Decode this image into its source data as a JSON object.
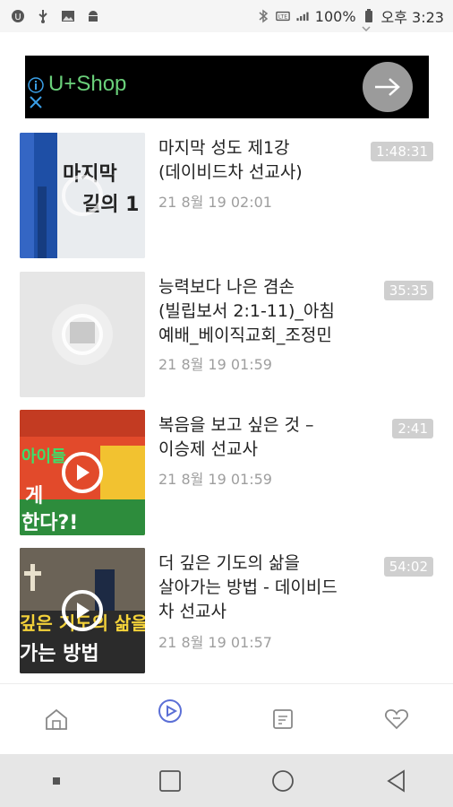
{
  "status_bar": {
    "battery": "100%",
    "time": "오후 3:23"
  },
  "ad": {
    "text": "U+Shop"
  },
  "videos": [
    {
      "title": "마지막 성도 제1강\n(데이비드차 선교사)",
      "date": "21 8월 19 02:01",
      "duration": "1:48:31",
      "thumb_text_1": "마지막",
      "thumb_text_2": "길의 1"
    },
    {
      "title": "능력보다 나은 겸손\n(빌립보서 2:1-11)_아침\n예배_베이직교회_조정민",
      "date": "21 8월 19 01:59",
      "duration": "35:35"
    },
    {
      "title": "복음을 보고 싶은 것 –\n이승제 선교사",
      "date": "21 8월 19 01:59",
      "duration": "2:41",
      "thumb_text_1": "아이들",
      "thumb_text_2": "게",
      "thumb_text_3": "한다?!"
    },
    {
      "title": "더 깊은 기도의 삶을\n살아가는 방법 - 데이비드\n차 선교사",
      "date": "21 8월 19 01:57",
      "duration": "54:02",
      "thumb_text_1": "깊은 기도의 삶을",
      "thumb_text_2": "가는 방법"
    }
  ],
  "bottom_nav": {
    "items": [
      "home",
      "videos",
      "board",
      "favorites"
    ],
    "active_color": "#5b6fd6"
  }
}
